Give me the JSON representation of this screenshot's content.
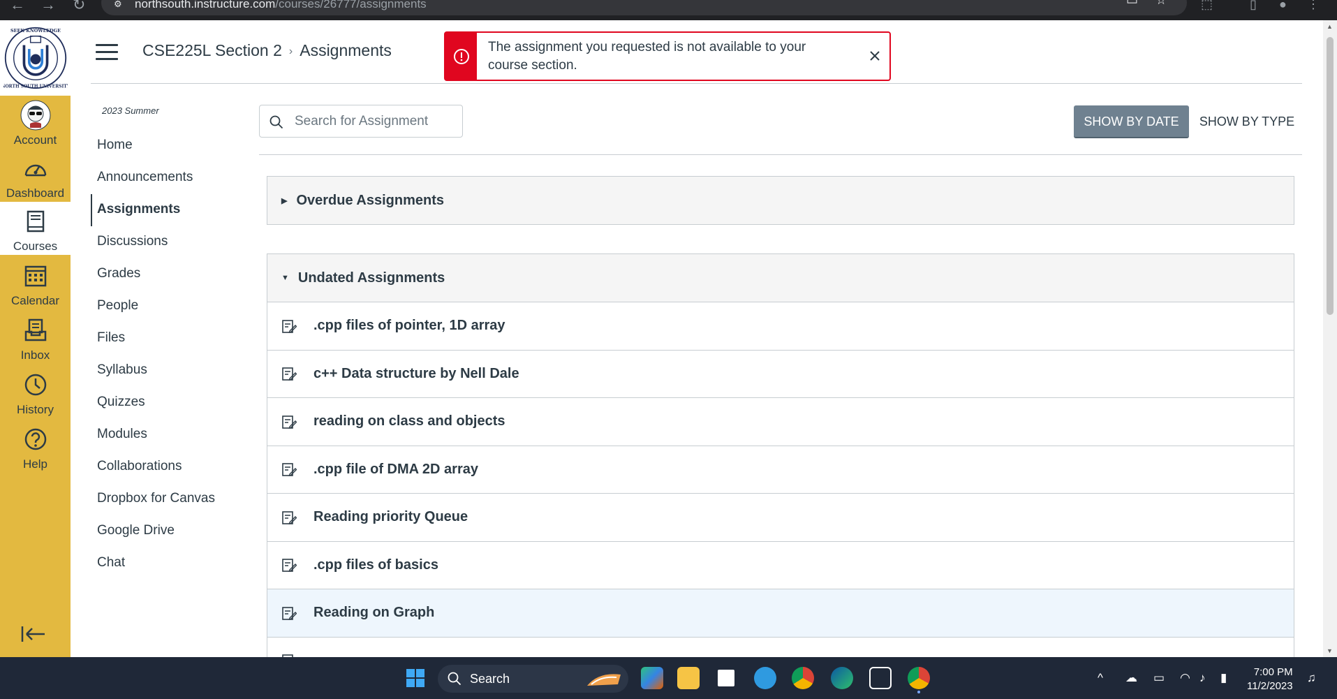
{
  "browser": {
    "url_prefix": "northsouth.instructure.com",
    "url_path": "/courses/26777/assignments"
  },
  "global_nav": {
    "logo_alt": "North South University",
    "items": [
      {
        "label": "Account",
        "icon": "account-avatar-icon",
        "active": false
      },
      {
        "label": "Dashboard",
        "icon": "dashboard-icon",
        "active": false
      },
      {
        "label": "Courses",
        "icon": "courses-icon",
        "active": true
      },
      {
        "label": "Calendar",
        "icon": "calendar-icon",
        "active": false
      },
      {
        "label": "Inbox",
        "icon": "inbox-icon",
        "active": false
      },
      {
        "label": "History",
        "icon": "history-icon",
        "active": false
      },
      {
        "label": "Help",
        "icon": "help-icon",
        "active": false
      }
    ],
    "accent_color": "#e3b940"
  },
  "header": {
    "course": "CSE225L Section 2",
    "separator": "›",
    "page": "Assignments"
  },
  "alert": {
    "message": "The assignment you requested is not available to your course section.",
    "color": "#e0061f"
  },
  "course_nav": {
    "term": "2023 Summer",
    "items": [
      {
        "label": "Home",
        "active": false
      },
      {
        "label": "Announcements",
        "active": false
      },
      {
        "label": "Assignments",
        "active": true
      },
      {
        "label": "Discussions",
        "active": false
      },
      {
        "label": "Grades",
        "active": false
      },
      {
        "label": "People",
        "active": false
      },
      {
        "label": "Files",
        "active": false
      },
      {
        "label": "Syllabus",
        "active": false
      },
      {
        "label": "Quizzes",
        "active": false
      },
      {
        "label": "Modules",
        "active": false
      },
      {
        "label": "Collaborations",
        "active": false
      },
      {
        "label": "Dropbox for Canvas",
        "active": false
      },
      {
        "label": "Google Drive",
        "active": false
      },
      {
        "label": "Chat",
        "active": false
      }
    ]
  },
  "toolbar": {
    "search_placeholder": "Search for Assignment",
    "show_by_date": "SHOW BY DATE",
    "show_by_type": "SHOW BY TYPE"
  },
  "groups": {
    "overdue": {
      "title": "Overdue Assignments",
      "expanded": false
    },
    "undated": {
      "title": "Undated Assignments",
      "expanded": true,
      "assignments": [
        ".cpp files of pointer, 1D array",
        "c++ Data structure by Nell Dale",
        "reading on class and objects",
        ".cpp file of DMA 2D array",
        "Reading priority Queue",
        ".cpp files of basics",
        "Reading on Graph"
      ]
    }
  },
  "taskbar": {
    "search_label": "Search",
    "time": "7:00 PM",
    "date": "11/2/2023"
  }
}
